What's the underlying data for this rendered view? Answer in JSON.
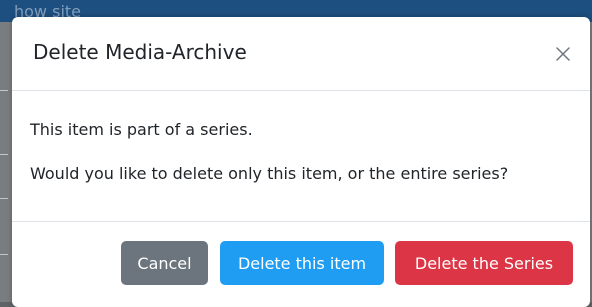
{
  "background": {
    "partial_text": "how site"
  },
  "dialog": {
    "title": "Delete Media-Archive",
    "close_icon": "close-icon",
    "message_line_1": "This item is part of a series.",
    "message_line_2": "Would you like to delete only this item, or the entire series?",
    "buttons": {
      "cancel": "Cancel",
      "delete_item": "Delete this item",
      "delete_series": "Delete the Series"
    }
  },
  "colors": {
    "cancel": "#6c757d",
    "primary": "#1e9df3",
    "danger": "#dc3545",
    "backdrop_bar": "#1d4f80"
  }
}
